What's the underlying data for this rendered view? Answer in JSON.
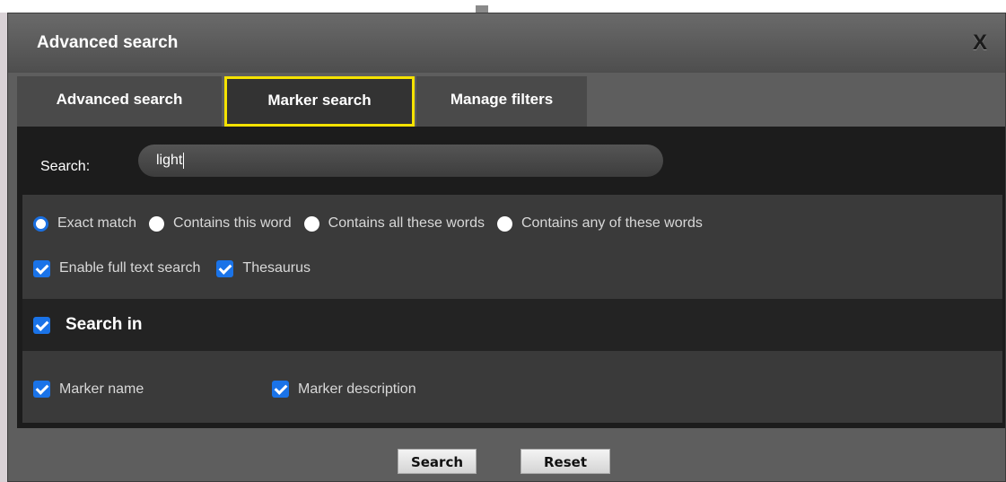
{
  "dialog": {
    "title": "Advanced search",
    "close_label": "X"
  },
  "tabs": [
    {
      "label": "Advanced search",
      "active": false
    },
    {
      "label": "Marker search",
      "active": true
    },
    {
      "label": "Manage filters",
      "active": false
    }
  ],
  "search": {
    "label": "Search:",
    "value": "light"
  },
  "match_modes": [
    {
      "label": "Exact match",
      "selected": true
    },
    {
      "label": "Contains this word",
      "selected": false
    },
    {
      "label": "Contains all these words",
      "selected": false
    },
    {
      "label": "Contains any of these words",
      "selected": false
    }
  ],
  "options": [
    {
      "label": "Enable full text search",
      "checked": true
    },
    {
      "label": "Thesaurus",
      "checked": true
    }
  ],
  "search_in": {
    "label": "Search in",
    "checked": true,
    "fields": [
      {
        "label": "Marker name",
        "checked": true
      },
      {
        "label": "Marker description",
        "checked": true
      }
    ]
  },
  "buttons": {
    "search": "Search",
    "reset": "Reset"
  },
  "colors": {
    "active_tab_outline": "#f5e200",
    "checkbox_blue": "#1a73e8",
    "radio_selected": "#1a6fe0"
  }
}
